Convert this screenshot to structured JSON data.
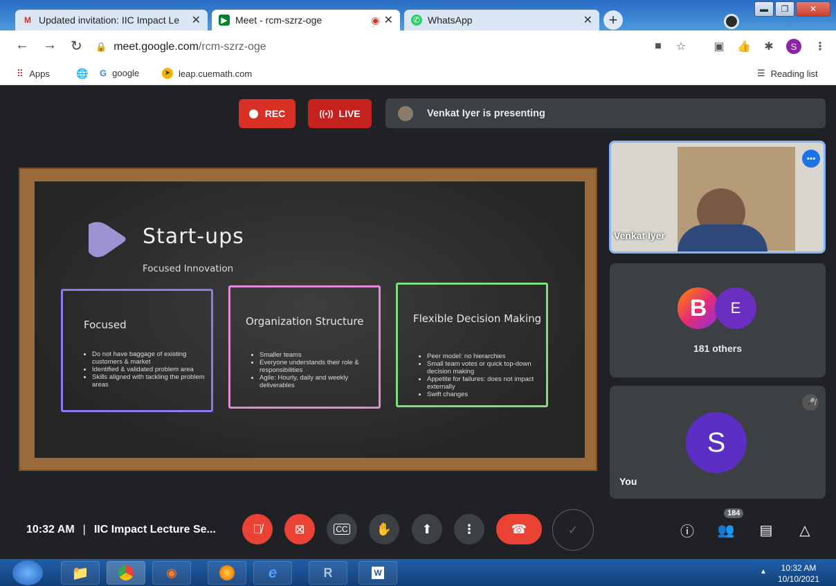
{
  "browser": {
    "tabs": [
      {
        "title": "Updated invitation: IIC Impact Le",
        "icon": "gmail-icon"
      },
      {
        "title": "Meet - rcm-szrz-oge",
        "icon": "meet-icon"
      },
      {
        "title": "WhatsApp",
        "icon": "whatsapp-icon"
      }
    ],
    "new_tab": "+",
    "url_domain": "meet.google.com",
    "url_path": "/rcm-szrz-oge",
    "profile_initial": "S",
    "bookmarks": [
      "Apps",
      "google",
      "leap.cuemath.com"
    ],
    "reading_list": "Reading list"
  },
  "meet": {
    "rec_label": "REC",
    "live_label": "LIVE",
    "presenting_text": "Venkat Iyer is presenting",
    "slide": {
      "title": "Start-ups",
      "subtitle": "Focused Innovation",
      "boxes": [
        {
          "title": "Focused",
          "color": "#8a7cf0",
          "bullets": [
            "Do not have baggage of existing customers & market",
            "Identified & validated problem area",
            "Skills aligned with tackling the problem areas"
          ]
        },
        {
          "title": "Organization Structure",
          "color": "#e08ad8",
          "bullets": [
            "Smaller teams",
            "Everyone understands their role & responsibilities",
            "Agile: Hourly, daily and weekly deliverables"
          ]
        },
        {
          "title": "Flexible Decision Making",
          "color": "#7ee07a",
          "bullets": [
            "Peer model: no hierarchies",
            "Small team votes or quick top-down decision making",
            "Appetite for failures: does not impact externally",
            "Swift changes"
          ]
        }
      ]
    },
    "presenter_name": "Venkat Iyer",
    "others_avatars": [
      "B",
      "E"
    ],
    "others_count_text": "181 others",
    "you_initial": "S",
    "you_label": "You",
    "time": "10:32 AM",
    "separator": "|",
    "meeting_title": "IIC Impact Lecture Se...",
    "participants_badge": "184"
  },
  "taskbar": {
    "clock_time": "10:32 AM",
    "clock_date": "10/10/2021"
  },
  "colors": {
    "rec": "#d93025",
    "live": "#c5221f",
    "end_call": "#ea4335",
    "avatar_s": "#5b2fc4",
    "avatar_e": "#6b2fbf"
  }
}
